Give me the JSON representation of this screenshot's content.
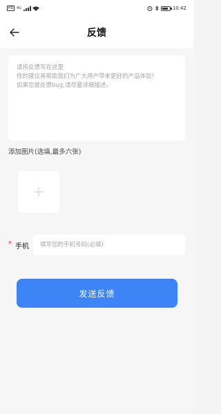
{
  "status_bar": {
    "sim_label": "HD",
    "network": "4G",
    "time": "10:42",
    "battery_level": 0.8
  },
  "header": {
    "title": "反馈"
  },
  "feedback": {
    "placeholder": "请将反馈写在这里\n你的建议将帮助我们为广大用户带来更好的产品体验!\n如果您是反馈bug,请尽量详细描述。"
  },
  "images": {
    "section_label": "添加图片(选填,最多六张)"
  },
  "phone": {
    "required_mark": "*",
    "label": "手机",
    "placeholder": "填写您的手机号码(必填)",
    "value": ""
  },
  "submit": {
    "label": "发送反馈"
  },
  "colors": {
    "accent": "#3d84f7",
    "required": "#e23030",
    "background": "#f6f6f6"
  }
}
